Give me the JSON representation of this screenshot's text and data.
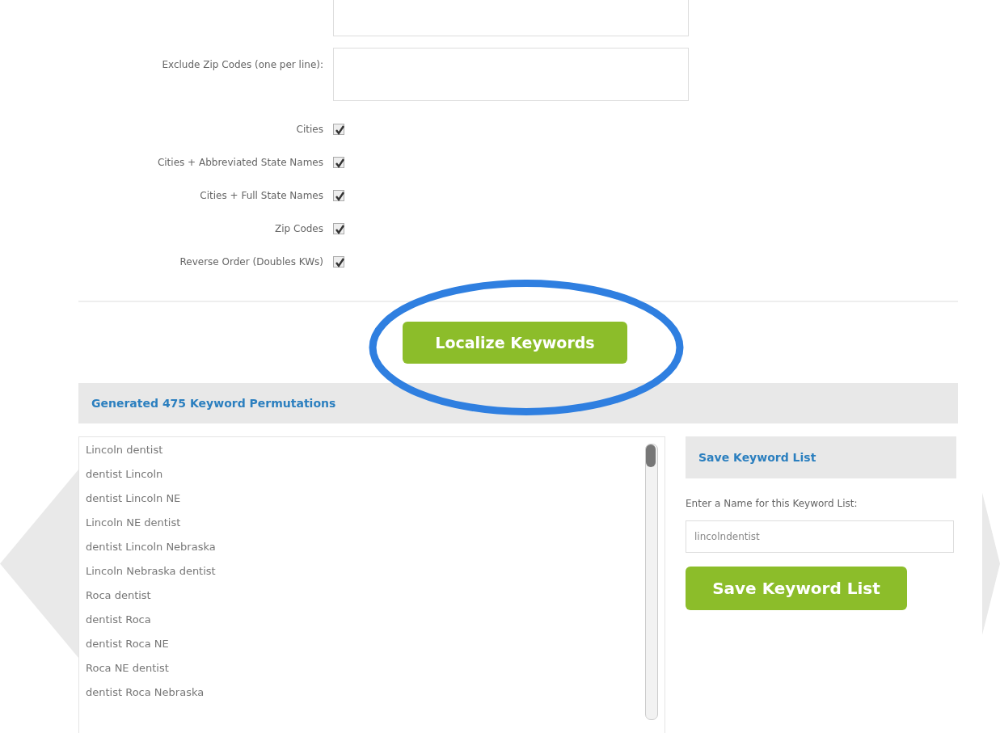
{
  "form": {
    "fields": [
      {
        "kind": "single"
      },
      {
        "label": "Exclude Zip Codes (one per line):",
        "kind": "multi"
      }
    ],
    "options": [
      {
        "label": "Cities",
        "checked": true
      },
      {
        "label": "Cities + Abbreviated State Names",
        "checked": true
      },
      {
        "label": "Cities + Full State Names",
        "checked": true
      },
      {
        "label": "Zip Codes",
        "checked": true
      },
      {
        "label": "Reverse Order (Doubles KWs)",
        "checked": true
      }
    ],
    "submit": "Localize Keywords"
  },
  "results": {
    "title": "Generated 475 Keyword Permutations",
    "keywords": [
      "Lincoln dentist",
      "dentist Lincoln",
      "dentist Lincoln NE",
      "Lincoln NE dentist",
      "dentist Lincoln Nebraska",
      "Lincoln Nebraska dentist",
      "Roca dentist",
      "dentist Roca",
      "dentist Roca NE",
      "Roca NE dentist",
      "dentist Roca Nebraska"
    ]
  },
  "save": {
    "title": "Save Keyword List",
    "prompt": "Enter a Name for this Keyword List:",
    "value": "lincolndentist",
    "button": "Save Keyword List"
  }
}
